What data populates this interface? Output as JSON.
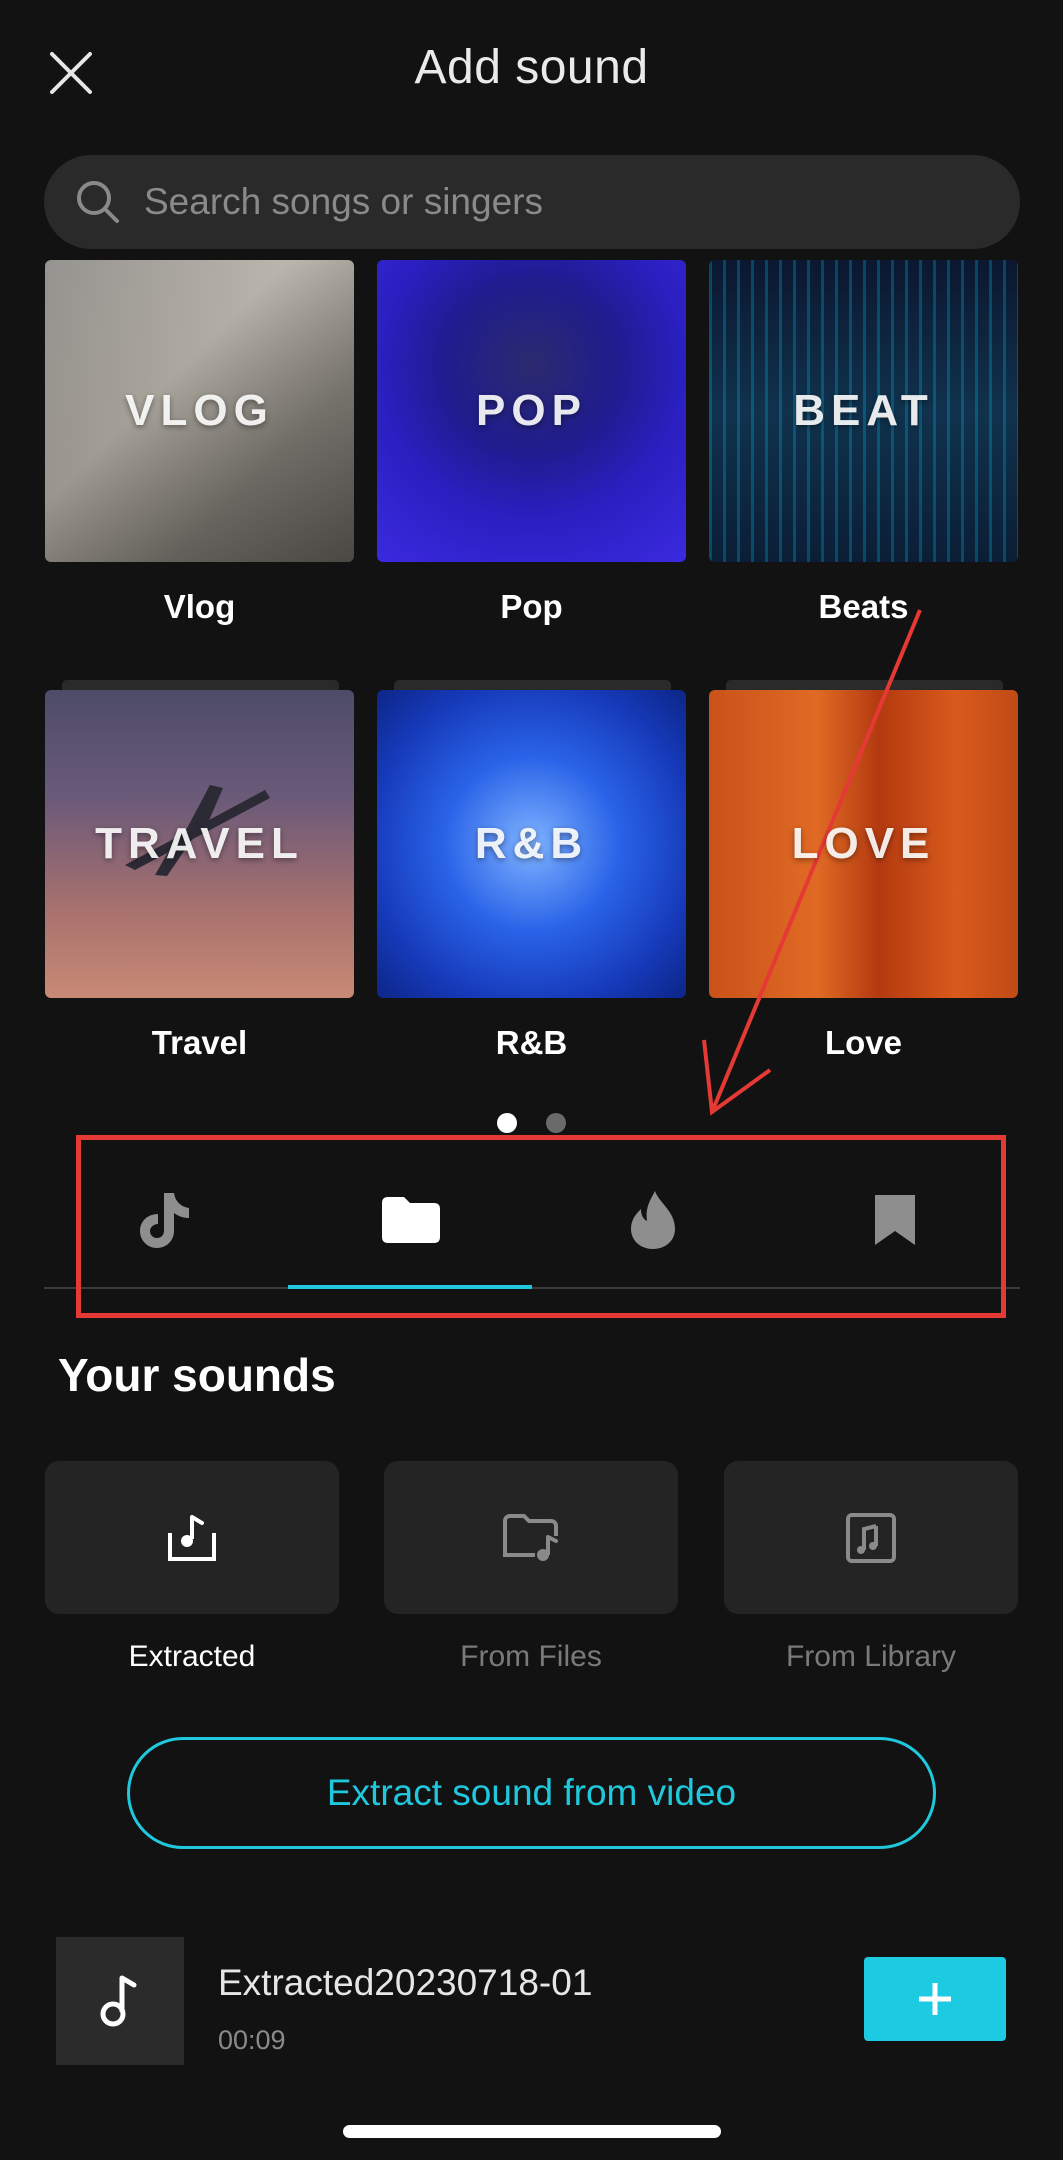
{
  "header": {
    "title": "Add sound",
    "close_icon": "close-icon"
  },
  "search": {
    "placeholder": "Search songs or singers",
    "value": "",
    "icon": "search-icon"
  },
  "genres": [
    {
      "overlay": "VLOG",
      "label": "Vlog"
    },
    {
      "overlay": "POP",
      "label": "Pop"
    },
    {
      "overlay": "BEAT",
      "label": "Beats"
    },
    {
      "overlay": "TRAVEL",
      "label": "Travel"
    },
    {
      "overlay": "R&B",
      "label": "R&B"
    },
    {
      "overlay": "LOVE",
      "label": "Love"
    }
  ],
  "pager": {
    "pages": 2,
    "active": 1
  },
  "tabs": [
    {
      "icon": "tiktok-icon",
      "active": false
    },
    {
      "icon": "folder-icon",
      "active": true
    },
    {
      "icon": "flame-icon",
      "active": false
    },
    {
      "icon": "bookmark-icon",
      "active": false
    }
  ],
  "your_sounds": {
    "title": "Your sounds",
    "sources": [
      {
        "label": "Extracted",
        "icon": "extract-audio-icon",
        "active": true
      },
      {
        "label": "From Files",
        "icon": "music-folder-icon",
        "active": false
      },
      {
        "label": "From Library",
        "icon": "music-library-icon",
        "active": false
      }
    ],
    "extract_button": "Extract sound from video"
  },
  "tracks": [
    {
      "title": "Extracted20230718-01",
      "duration": "00:09",
      "icon": "music-note-icon",
      "add_icon": "plus-icon"
    }
  ],
  "colors": {
    "background": "#121212",
    "accent": "#1fc8dc",
    "annotation": "#e53935"
  }
}
